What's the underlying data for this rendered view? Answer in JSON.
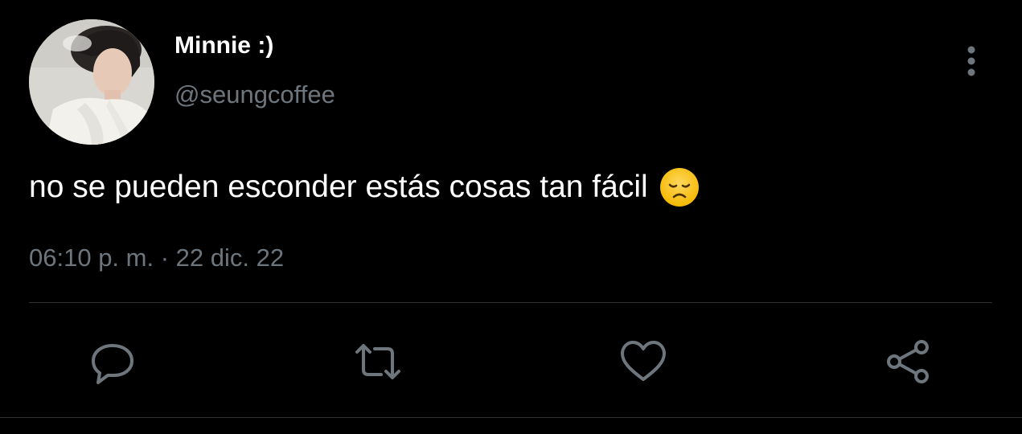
{
  "author": {
    "display_name": "Minnie :)",
    "handle": "@seungcoffee"
  },
  "tweet": {
    "text": "no se pueden esconder estás cosas tan fácil",
    "emoji": "disappointed-face",
    "time": "06:10 p. m.",
    "separator": "·",
    "date": "22 dic. 22"
  },
  "actions": {
    "icons": [
      "reply-icon",
      "retweet-icon",
      "like-icon",
      "share-icon"
    ]
  },
  "colors": {
    "background": "#000000",
    "primary_text": "#ffffff",
    "secondary_text": "#6e767d",
    "icon": "#6e767d",
    "divider": "#2f3336"
  }
}
